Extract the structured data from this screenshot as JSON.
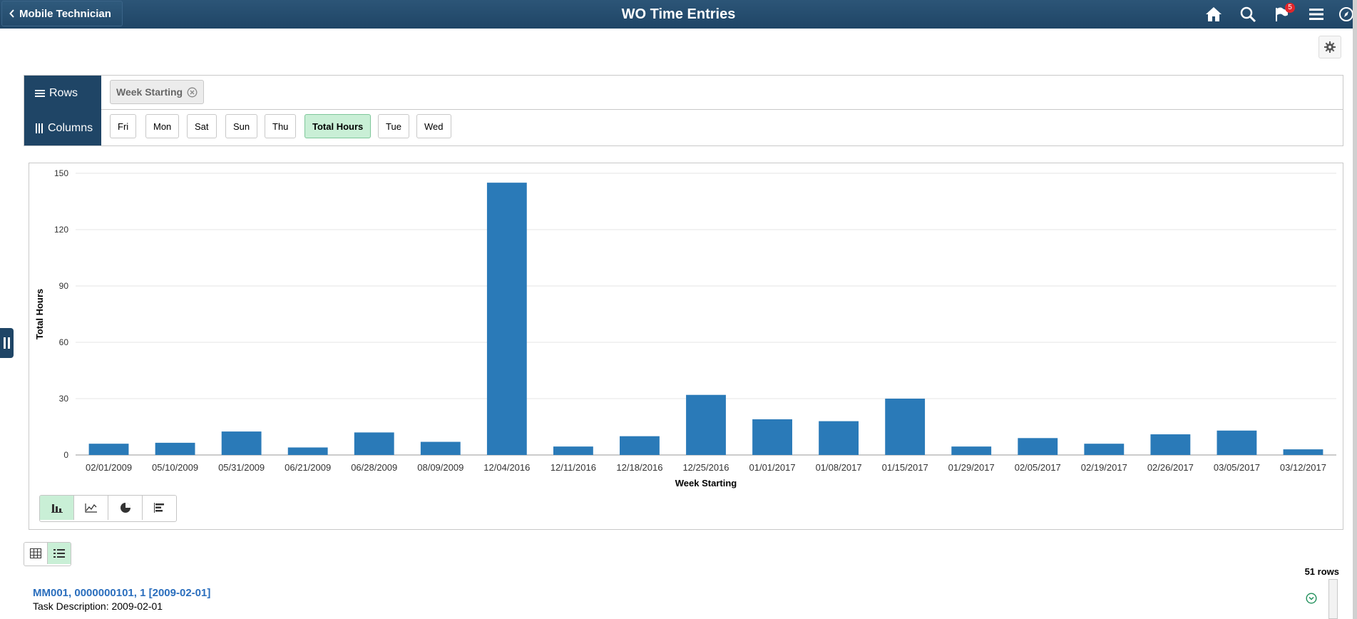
{
  "header": {
    "back_label": "Mobile Technician",
    "title": "WO Time Entries",
    "notification_count": "5",
    "icons": [
      "home-icon",
      "search-icon",
      "notifications-flag-icon",
      "menu-icon",
      "navbar-compass-icon"
    ]
  },
  "pivot": {
    "rows_label": "Rows",
    "columns_label": "Columns",
    "row_fields": [
      {
        "label": "Week Starting"
      }
    ],
    "column_fields": [
      {
        "label": "Fri",
        "active": false
      },
      {
        "label": "Mon",
        "active": false
      },
      {
        "label": "Sat",
        "active": false
      },
      {
        "label": "Sun",
        "active": false
      },
      {
        "label": "Thu",
        "active": false
      },
      {
        "label": "Total Hours",
        "active": true
      },
      {
        "label": "Tue",
        "active": false
      },
      {
        "label": "Wed",
        "active": false
      }
    ]
  },
  "chart_data": {
    "type": "bar",
    "title": "",
    "xlabel": "Week Starting",
    "ylabel": "Total Hours",
    "ylim": [
      0,
      150
    ],
    "yticks": [
      0,
      30,
      60,
      90,
      120,
      150
    ],
    "grid": true,
    "legend": "none",
    "bar_color": "#2a7ab8",
    "categories": [
      "02/01/2009",
      "05/10/2009",
      "05/31/2009",
      "06/21/2009",
      "06/28/2009",
      "08/09/2009",
      "12/04/2016",
      "12/11/2016",
      "12/18/2016",
      "12/25/2016",
      "01/01/2017",
      "01/08/2017",
      "01/15/2017",
      "01/29/2017",
      "02/05/2017",
      "02/19/2017",
      "02/26/2017",
      "03/05/2017",
      "03/12/2017"
    ],
    "values": [
      6,
      6.5,
      12.5,
      4,
      12,
      7,
      145,
      4.5,
      10,
      32,
      19,
      18,
      30,
      4.5,
      9,
      6,
      11,
      13,
      3
    ]
  },
  "chart_types": [
    {
      "name": "bar",
      "active": true
    },
    {
      "name": "line",
      "active": false
    },
    {
      "name": "pie",
      "active": false
    },
    {
      "name": "horizontal-bar",
      "active": false
    }
  ],
  "list": {
    "rows_count": "51 rows",
    "first_item": {
      "title": "MM001, 0000000101, 1 [2009-02-01]",
      "description_label": "Task Description:",
      "description_value": "2009-02-01"
    }
  },
  "colors": {
    "header_bg": "#1f4566",
    "accent_active": "#c9efd6",
    "link": "#2a6ebd"
  }
}
